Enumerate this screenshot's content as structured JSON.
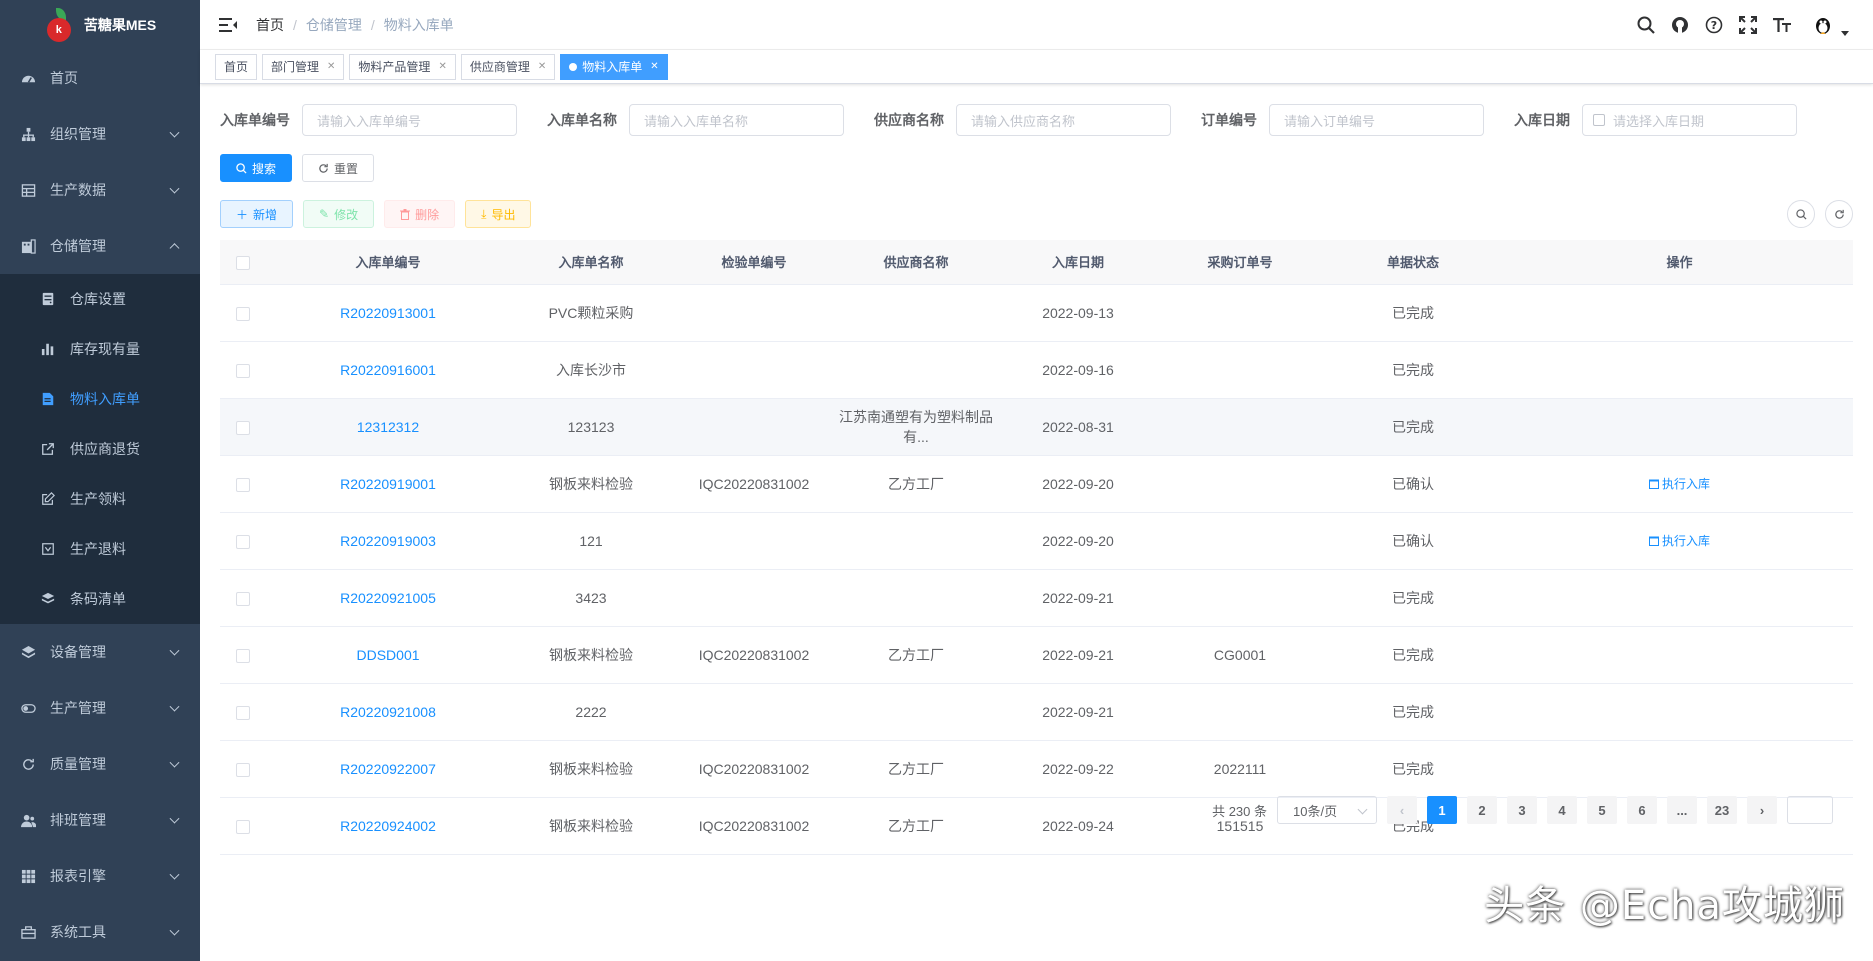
{
  "app": {
    "logo_text": "苦糖果MES",
    "logo_letter": "k"
  },
  "sidebar": {
    "items": [
      {
        "label": "首页",
        "icon": "dashboard-icon"
      },
      {
        "label": "组织管理",
        "icon": "tree-icon"
      },
      {
        "label": "生产数据",
        "icon": "table-icon"
      },
      {
        "label": "仓储管理",
        "icon": "build-icon",
        "expanded": true
      },
      {
        "label": "设备管理",
        "icon": "layers-icon"
      },
      {
        "label": "生产管理",
        "icon": "toggle-icon"
      },
      {
        "label": "质量管理",
        "icon": "refresh-icon"
      },
      {
        "label": "排班管理",
        "icon": "people-icon"
      },
      {
        "label": "报表引擎",
        "icon": "grid-icon"
      },
      {
        "label": "系统工具",
        "icon": "toolbox-icon"
      }
    ],
    "subitems": [
      {
        "label": "仓库设置",
        "icon": "server-icon"
      },
      {
        "label": "库存现有量",
        "icon": "bar-chart-icon"
      },
      {
        "label": "物料入库单",
        "icon": "document-icon",
        "active": true
      },
      {
        "label": "供应商退货",
        "icon": "external-link-icon"
      },
      {
        "label": "生产领料",
        "icon": "edit-icon"
      },
      {
        "label": "生产退料",
        "icon": "return-icon"
      },
      {
        "label": "条码清单",
        "icon": "barcode-stack-icon"
      }
    ]
  },
  "navbar": {
    "breadcrumb": [
      "首页",
      "仓储管理",
      "物料入库单"
    ]
  },
  "tags": [
    {
      "label": "首页",
      "closable": false
    },
    {
      "label": "部门管理",
      "closable": true
    },
    {
      "label": "物料产品管理",
      "closable": true
    },
    {
      "label": "供应商管理",
      "closable": true
    },
    {
      "label": "物料入库单",
      "closable": true,
      "active": true
    }
  ],
  "search": {
    "fields": [
      {
        "label": "入库单编号",
        "placeholder": "请输入入库单编号"
      },
      {
        "label": "入库单名称",
        "placeholder": "请输入入库单名称"
      },
      {
        "label": "供应商名称",
        "placeholder": "请输入供应商名称"
      },
      {
        "label": "订单编号",
        "placeholder": "请输入订单编号"
      },
      {
        "label": "入库日期",
        "placeholder": "请选择入库日期"
      }
    ],
    "search_label": "搜索",
    "reset_label": "重置"
  },
  "toolbar": {
    "add_label": "新增",
    "edit_label": "修改",
    "delete_label": "删除",
    "export_label": "导出"
  },
  "table": {
    "headers": [
      "入库单编号",
      "入库单名称",
      "检验单编号",
      "供应商名称",
      "入库日期",
      "采购订单号",
      "单据状态",
      "操作"
    ],
    "rows": [
      {
        "code": "R20220913001",
        "name": "PVC颗粒采购",
        "iqc": "",
        "vendor": "",
        "date": "2022-09-13",
        "po": "",
        "status": "已完成",
        "op": ""
      },
      {
        "code": "R20220916001",
        "name": "入库长沙市",
        "iqc": "",
        "vendor": "",
        "date": "2022-09-16",
        "po": "",
        "status": "已完成",
        "op": ""
      },
      {
        "code": "12312312",
        "name": "123123",
        "iqc": "",
        "vendor": "江苏南通塑有为塑料制品有...",
        "date": "2022-08-31",
        "po": "",
        "status": "已完成",
        "op": ""
      },
      {
        "code": "R20220919001",
        "name": "钢板来料检验",
        "iqc": "IQC20220831002",
        "vendor": "乙方工厂",
        "date": "2022-09-20",
        "po": "",
        "status": "已确认",
        "op": "执行入库"
      },
      {
        "code": "R20220919003",
        "name": "121",
        "iqc": "",
        "vendor": "",
        "date": "2022-09-20",
        "po": "",
        "status": "已确认",
        "op": "执行入库"
      },
      {
        "code": "R20220921005",
        "name": "3423",
        "iqc": "",
        "vendor": "",
        "date": "2022-09-21",
        "po": "",
        "status": "已完成",
        "op": ""
      },
      {
        "code": "DDSD001",
        "name": "钢板来料检验",
        "iqc": "IQC20220831002",
        "vendor": "乙方工厂",
        "date": "2022-09-21",
        "po": "CG0001",
        "status": "已完成",
        "op": ""
      },
      {
        "code": "R20220921008",
        "name": "2222",
        "iqc": "",
        "vendor": "",
        "date": "2022-09-21",
        "po": "",
        "status": "已完成",
        "op": ""
      },
      {
        "code": "R20220922007",
        "name": "钢板来料检验",
        "iqc": "IQC20220831002",
        "vendor": "乙方工厂",
        "date": "2022-09-22",
        "po": "2022111",
        "status": "已完成",
        "op": ""
      },
      {
        "code": "R20220924002",
        "name": "钢板来料检验",
        "iqc": "IQC20220831002",
        "vendor": "乙方工厂",
        "date": "2022-09-24",
        "po": "151515",
        "status": "已完成",
        "op": ""
      }
    ]
  },
  "pagination": {
    "total_text": "共 230 条",
    "page_size": "10条/页",
    "pages": [
      "1",
      "2",
      "3",
      "4",
      "5",
      "6",
      "...",
      "23"
    ],
    "current": "1"
  },
  "watermark": "头条 @Echa攻城狮",
  "colors": {
    "sidebar_bg": "#304156",
    "submenu_bg": "#1f2d3d",
    "accent": "#1890ff"
  }
}
